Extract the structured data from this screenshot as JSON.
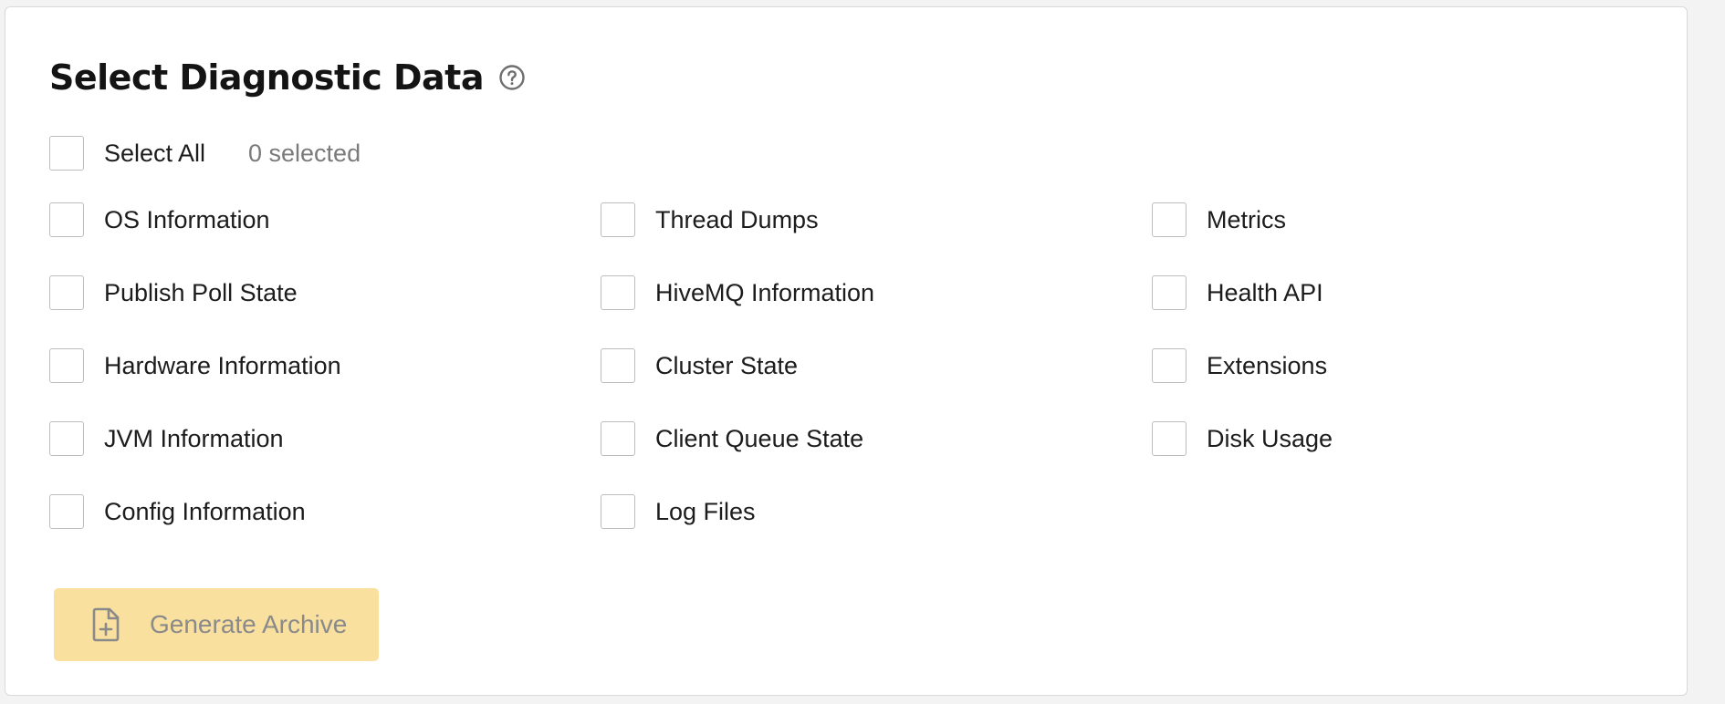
{
  "title": "Select Diagnostic Data",
  "help_icon": "help-circle-icon",
  "select_all": {
    "label": "Select All",
    "count_text": "0 selected",
    "checked": false
  },
  "columns": [
    {
      "items": [
        {
          "label": "OS Information",
          "checked": false
        },
        {
          "label": "Publish Poll State",
          "checked": false
        },
        {
          "label": "Hardware Information",
          "checked": false
        },
        {
          "label": "JVM Information",
          "checked": false
        },
        {
          "label": "Config Information",
          "checked": false
        }
      ]
    },
    {
      "items": [
        {
          "label": "Thread Dumps",
          "checked": false
        },
        {
          "label": "HiveMQ Information",
          "checked": false
        },
        {
          "label": "Cluster State",
          "checked": false
        },
        {
          "label": "Client Queue State",
          "checked": false
        },
        {
          "label": "Log Files",
          "checked": false
        }
      ]
    },
    {
      "items": [
        {
          "label": "Metrics",
          "checked": false
        },
        {
          "label": "Health API",
          "checked": false
        },
        {
          "label": "Extensions",
          "checked": false
        },
        {
          "label": "Disk Usage",
          "checked": false
        }
      ]
    }
  ],
  "generate_button": {
    "label": "Generate Archive",
    "icon": "file-plus-icon",
    "disabled": true
  },
  "colors": {
    "button_background": "#f9e09e",
    "button_text": "#8a8a8a",
    "checkbox_border": "#bdbdbd",
    "muted_text": "#7a7a7a"
  }
}
